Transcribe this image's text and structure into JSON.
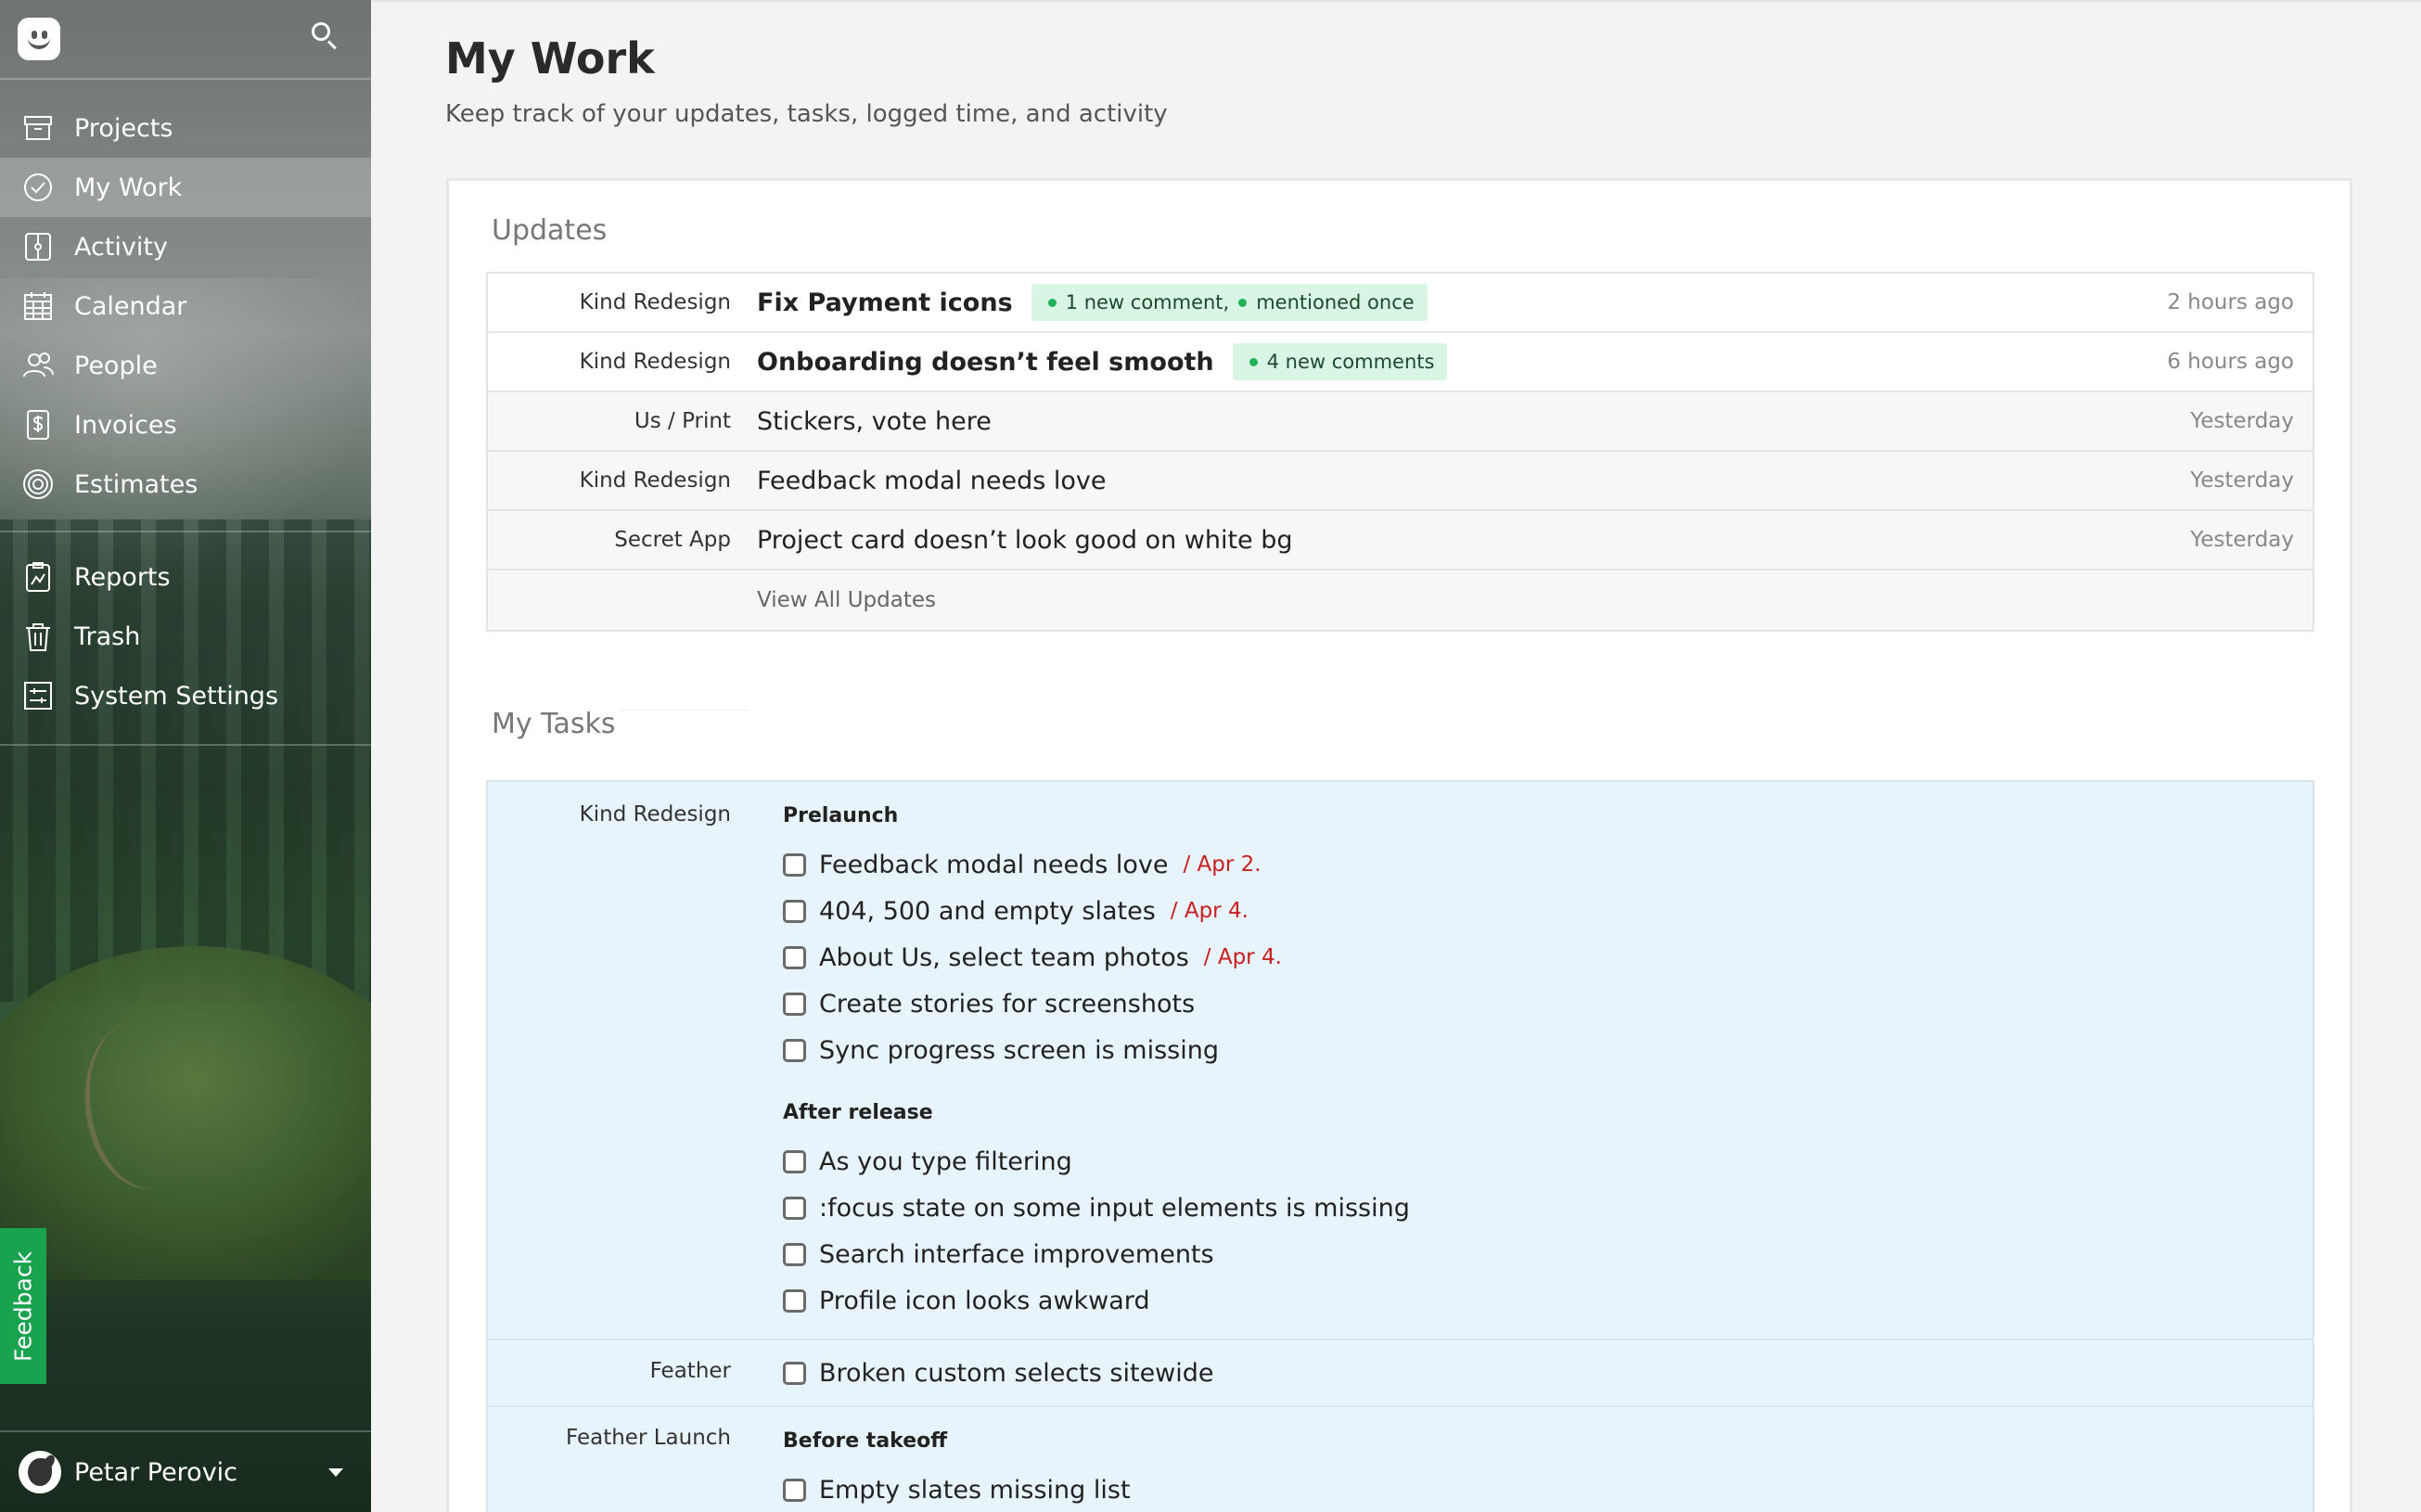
{
  "sidebar": {
    "nav_primary": [
      {
        "label": "Projects",
        "icon": "archive-box-icon"
      },
      {
        "label": "My Work",
        "icon": "check-circle-icon",
        "active": true
      },
      {
        "label": "Activity",
        "icon": "activity-icon"
      },
      {
        "label": "Calendar",
        "icon": "calendar-icon"
      },
      {
        "label": "People",
        "icon": "people-icon"
      },
      {
        "label": "Invoices",
        "icon": "dollar-document-icon"
      },
      {
        "label": "Estimates",
        "icon": "target-icon"
      }
    ],
    "nav_secondary": [
      {
        "label": "Reports",
        "icon": "report-clipboard-icon"
      },
      {
        "label": "Trash",
        "icon": "trash-icon"
      },
      {
        "label": "System Settings",
        "icon": "settings-sliders-icon"
      }
    ],
    "feedback_label": "Feedback",
    "user_name": "Petar Perovic"
  },
  "header": {
    "title": "My Work",
    "subtitle": "Keep track of your updates, tasks, logged time, and activity"
  },
  "updates": {
    "title": "Updates",
    "rows": [
      {
        "project": "Kind Redesign",
        "title": "Fix Payment icons",
        "unread": true,
        "badge": [
          "1 new comment,",
          "mentioned once"
        ],
        "time": "2 hours ago"
      },
      {
        "project": "Kind Redesign",
        "title": "Onboarding doesn’t feel smooth",
        "unread": true,
        "badge": [
          "4 new comments"
        ],
        "time": "6 hours ago"
      },
      {
        "project": "Us / Print",
        "title": "Stickers, vote here",
        "unread": false,
        "badge": [],
        "time": "Yesterday"
      },
      {
        "project": "Kind Redesign",
        "title": "Feedback modal needs love",
        "unread": false,
        "badge": [],
        "time": "Yesterday"
      },
      {
        "project": "Secret App",
        "title": "Project card doesn’t look good on white bg",
        "unread": false,
        "badge": [],
        "time": "Yesterday"
      }
    ],
    "view_all": "View All Updates"
  },
  "tasks": {
    "title": "My Tasks",
    "blocks": [
      {
        "project": "Kind Redesign",
        "groups": [
          {
            "name": "Prelaunch",
            "items": [
              {
                "text": "Feedback modal needs love",
                "due": "/ Apr 2."
              },
              {
                "text": "404, 500 and empty slates",
                "due": "/ Apr 4."
              },
              {
                "text": "About Us, select team photos",
                "due": "/ Apr 4."
              },
              {
                "text": "Create stories for screenshots",
                "due": ""
              },
              {
                "text": "Sync progress screen is missing",
                "due": ""
              }
            ]
          },
          {
            "name": "After release",
            "items": [
              {
                "text": "As you type filtering",
                "due": ""
              },
              {
                "text": ":focus state on some input elements is missing",
                "due": ""
              },
              {
                "text": "Search interface improvements",
                "due": ""
              },
              {
                "text": "Profile icon looks awkward",
                "due": ""
              }
            ]
          }
        ]
      },
      {
        "project": "Feather",
        "groups": [
          {
            "name": "",
            "items": [
              {
                "text": "Broken custom selects sitewide",
                "due": ""
              }
            ]
          }
        ]
      },
      {
        "project": "Feather Launch",
        "groups": [
          {
            "name": "Before takeoff",
            "items": [
              {
                "text": "Empty slates missing list",
                "due": ""
              }
            ]
          }
        ]
      }
    ]
  },
  "colors": {
    "accent_green": "#1aa34f",
    "badge_bg": "#d9f5e4",
    "due_red": "#c81e1e",
    "tasks_bg": "#e8f4fc"
  }
}
